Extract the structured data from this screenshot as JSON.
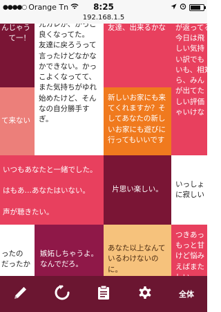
{
  "status_bar": {
    "carrier": "Orange Tn",
    "time": "8:25"
  },
  "url_bar": {
    "url": "192.168.1.5"
  },
  "tiles": {
    "r1c1": "んじゃう\nて一！",
    "r1c2": "元カレが、かっこ良くなってた。\n友達に戻ろうって言ったけどなかなかできない。かっこよくなってて、また気持ちがゆれ始めたけど、そんなの自分勝手すぎ。",
    "r1c3": "友達、出来るかな",
    "r1c4": "が返ってる\n今日は飛\nしい気持\nい訳でも\nいも、相対\nら、みん\nが出てた\nしい評価\nゃいけな",
    "r2c1": "て来ない",
    "r2c3": "新しいお家にも来てくれますか？そしてあなたの新しいお家にも遊びに行ってもいいです",
    "r3c1": "いつもあなたと一緒でした。\n\nはもあ…あなたはいない。\n\n声が聴きたい。",
    "r3c3": "片思い楽しい。",
    "r3c4": "いっしょ\nに寂しい",
    "r4c1": "ったの\nだったか",
    "r4c2": "嫉妬しちゃうよ。\nなんでだろ。",
    "r4c3": "あなた以上なんて\nいるわけないのに。",
    "r4c4": "つきあっ\nもっと甘\nけど悩み\nえばまた\nしい。"
  },
  "toolbar": {
    "all_label": "全体"
  },
  "colors": {
    "pink": "#e8405e",
    "burgundy": "#7a1535",
    "salmon": "#ec7f7a",
    "orange": "#f07a1e",
    "peach": "#f6c27c",
    "magenta": "#8f1848",
    "toolbar": "#6b1631"
  },
  "icons": [
    "pencil-icon",
    "refresh-icon",
    "clipboard-icon",
    "gear-icon"
  ]
}
